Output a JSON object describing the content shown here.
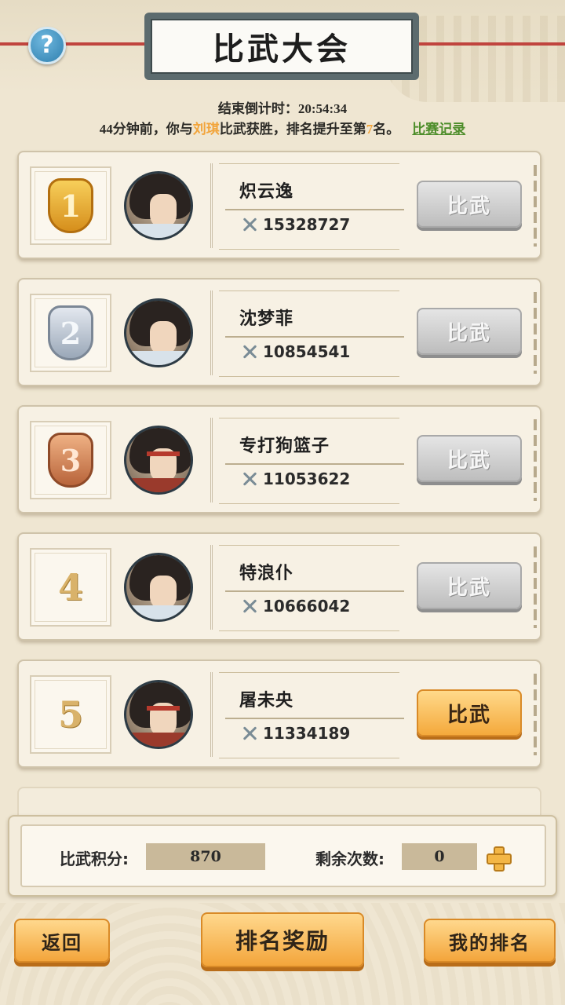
{
  "header": {
    "title": "比武大会",
    "help_symbol": "?"
  },
  "countdown": {
    "label": "结束倒计时：",
    "time": "20:54:34"
  },
  "notice": {
    "prefix": "44分钟前，你与",
    "opponent": "刘琪",
    "middle": "比武获胜，排名提升至第",
    "rank": "7",
    "suffix": "名。",
    "record_link": "比赛记录"
  },
  "fight_label": "比武",
  "ranking": [
    {
      "rank": "1",
      "medal": "gold",
      "name": "炽云逸",
      "power": "15328727",
      "avatar": "white-robe",
      "active": false
    },
    {
      "rank": "2",
      "medal": "silver",
      "name": "沈梦菲",
      "power": "10854541",
      "avatar": "white-robe",
      "active": false
    },
    {
      "rank": "3",
      "medal": "bronze",
      "name": "专打狗篮子",
      "power": "11053622",
      "avatar": "red-headband",
      "active": false
    },
    {
      "rank": "4",
      "medal": "none",
      "name": "特浪仆",
      "power": "10666042",
      "avatar": "white-robe",
      "active": false
    },
    {
      "rank": "5",
      "medal": "none",
      "name": "屠未央",
      "power": "11334189",
      "avatar": "red-headband",
      "active": true
    }
  ],
  "stats": {
    "score_label": "比武积分:",
    "score_value": "870",
    "remaining_label": "剩余次数:",
    "remaining_value": "0"
  },
  "buttons": {
    "back": "返回",
    "rank_reward": "排名奖励",
    "my_rank": "我的排名"
  },
  "colors": {
    "background": "#efe6d2",
    "highlight": "#f2a43a",
    "link": "#4d8d2a",
    "button_active": "#f4a93c",
    "button_disabled": "#bdbdbd"
  }
}
